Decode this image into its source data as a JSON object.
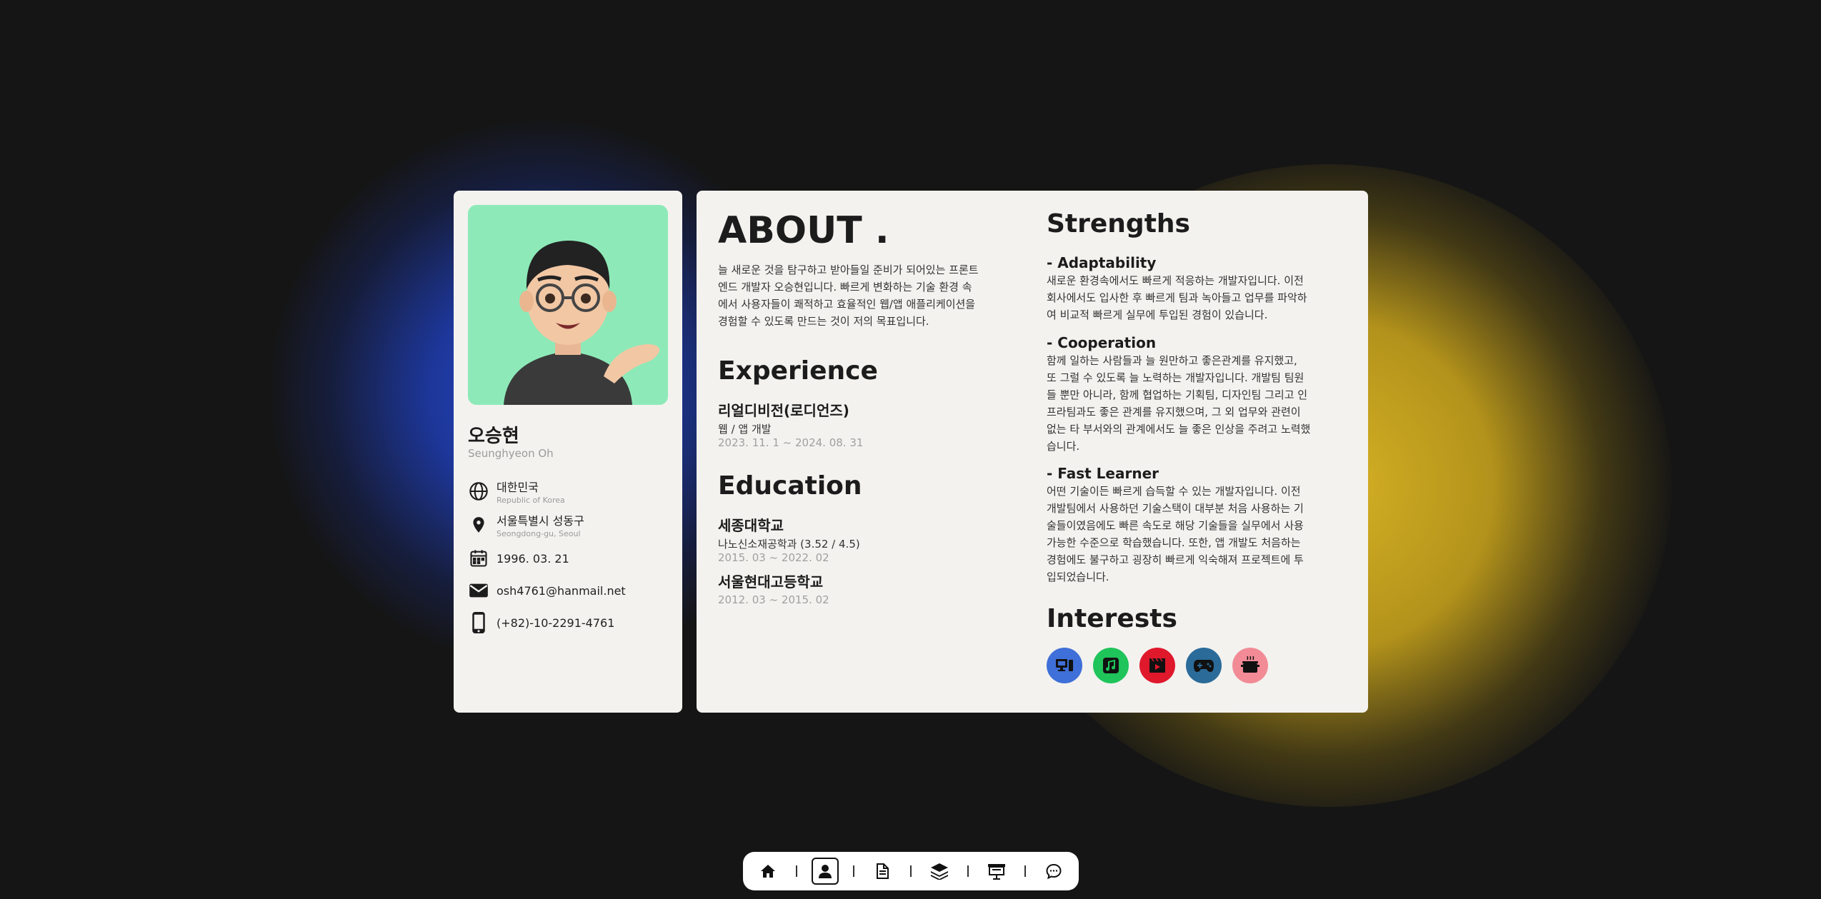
{
  "profile": {
    "name": "오승현",
    "name_en": "Seunghyeon Oh",
    "country": "대한민국",
    "country_en": "Republic of Korea",
    "location": "서울특별시 성동구",
    "location_en": "Seongdong-gu, Seoul",
    "birth": "1996. 03. 21",
    "email": "osh4761@hanmail.net",
    "phone": "(+82)-10-2291-4761",
    "icons": [
      "globe-icon",
      "location-pin-icon",
      "calendar-icon",
      "mail-icon",
      "phone-icon"
    ]
  },
  "about": {
    "title": "ABOUT .",
    "lines": [
      "늘 새로운 것을 탐구하고 받아들일 준비가 되어있는 프론트",
      "엔드 개발자 오승현입니다. 빠르게 변화하는 기술 환경 속",
      "에서 사용자들이 쾌적하고 효율적인 웹/앱 애플리케이션을",
      "경험할 수 있도록 만드는 것이 저의 목표입니다."
    ]
  },
  "experience": {
    "title": "Experience",
    "company": "리얼디비전(로디언즈)",
    "role": "웹 / 앱 개발",
    "period": "2023. 11. 1 ~ 2024. 08. 31"
  },
  "education": {
    "title": "Education",
    "items": [
      {
        "school": "세종대학교",
        "detail": "나노신소재공학과 (3.52 / 4.5)",
        "period": "2015. 03 ~ 2022. 02"
      },
      {
        "school": "서울현대고등학교",
        "detail": "",
        "period": "2012. 03 ~ 2015. 02"
      }
    ]
  },
  "strengths": {
    "title": "Strengths",
    "items": [
      {
        "heading": "- Adaptability",
        "lines": [
          "새로운 환경속에서도 빠르게 적응하는 개발자입니다. 이전",
          "회사에서도 입사한 후 빠르게 팀과 녹아들고 업무를 파악하",
          "여 비교적 빠르게 실무에 투입된 경험이 있습니다."
        ]
      },
      {
        "heading": "- Cooperation",
        "lines": [
          "함께 일하는 사람들과 늘 원만하고 좋은관계를 유지했고,",
          "또 그럴 수 있도록 늘 노력하는 개발자입니다. 개발팀 팀원",
          "들 뿐만 아니라, 함께 협업하는 기획팀, 디자인팀 그리고 인",
          "프라팀과도 좋은 관계를 유지했으며, 그 외 업무와 관련이",
          "없는 타 부서와의 관계에서도 늘 좋은 인상을 주려고 노력했",
          "습니다."
        ]
      },
      {
        "heading": "- Fast Learner",
        "lines": [
          "어떤 기술이든 빠르게 습득할 수 있는 개발자입니다. 이전",
          "개발팀에서 사용하던 기술스택이 대부분 처음 사용하는 기",
          "술들이였음에도 빠른 속도로 해당 기술들을 실무에서 사용",
          "가능한 수준으로 학습했습니다. 또한, 앱 개발도 처음하는",
          "경험에도 불구하고 굉장히 빠르게 익숙해져 프로젝트에 투",
          "입되었습니다."
        ]
      }
    ]
  },
  "interests": {
    "title": "Interests",
    "items": [
      {
        "icon": "computer-icon",
        "color": "#3f6fd8"
      },
      {
        "icon": "music-icon",
        "color": "#1fc45a"
      },
      {
        "icon": "movie-icon",
        "color": "#e0182c"
      },
      {
        "icon": "gamepad-icon",
        "color": "#2a6b99"
      },
      {
        "icon": "cooking-pot-icon",
        "color": "#f28b96"
      }
    ]
  },
  "dock": {
    "items": [
      "home-icon",
      "profile-icon",
      "document-icon",
      "layers-icon",
      "presentation-icon",
      "chat-icon"
    ],
    "active": "profile-icon"
  },
  "colors": {
    "background": "#151515",
    "card": "#f3f2ef",
    "avatar_bg": "#8deab8",
    "glow_blue": "#2646c8",
    "glow_yellow": "#d6b224"
  }
}
